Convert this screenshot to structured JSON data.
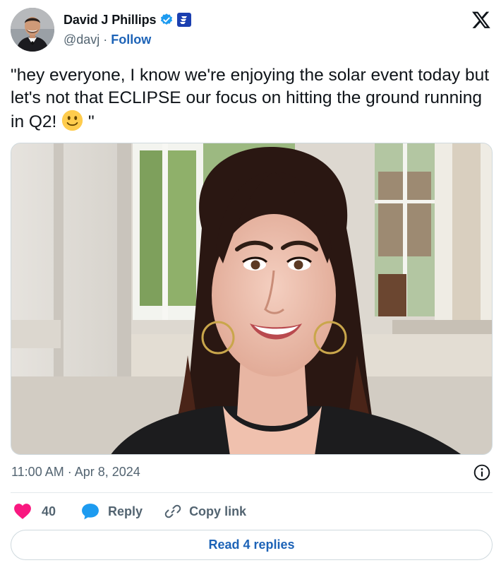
{
  "author": {
    "display_name": "David J Phillips",
    "handle": "@davj",
    "separator": " · ",
    "follow_label": "Follow",
    "avatar_icon": "person-avatar",
    "verified_icon": "verified-badge-icon",
    "affiliation_icon": "affiliate-badge-icon"
  },
  "brand": {
    "logo_icon": "x-logo-icon"
  },
  "tweet": {
    "text_before_emoji": "\"hey everyone, I know we're enjoying the solar event today but let's not that ECLIPSE our focus on hitting the ground running in Q2! ",
    "emoji_icon": "slightly-smiling-face",
    "text_after_emoji": " \"",
    "media_icon": "photo-smiling-woman-in-room"
  },
  "meta": {
    "timestamp": "11:00 AM · Apr 8, 2024",
    "info_icon": "info-icon"
  },
  "actions": {
    "like_count": "40",
    "reply_label": "Reply",
    "copy_link_label": "Copy link"
  },
  "replies_button": {
    "label": "Read 4 replies"
  },
  "colors": {
    "text": "#0f1419",
    "secondary": "#536471",
    "link_blue": "#1d63b7",
    "like_red": "#f91880",
    "reply_blue": "#1d9bf0",
    "verified_blue": "#1d9bf0",
    "border": "#cfd9de"
  }
}
